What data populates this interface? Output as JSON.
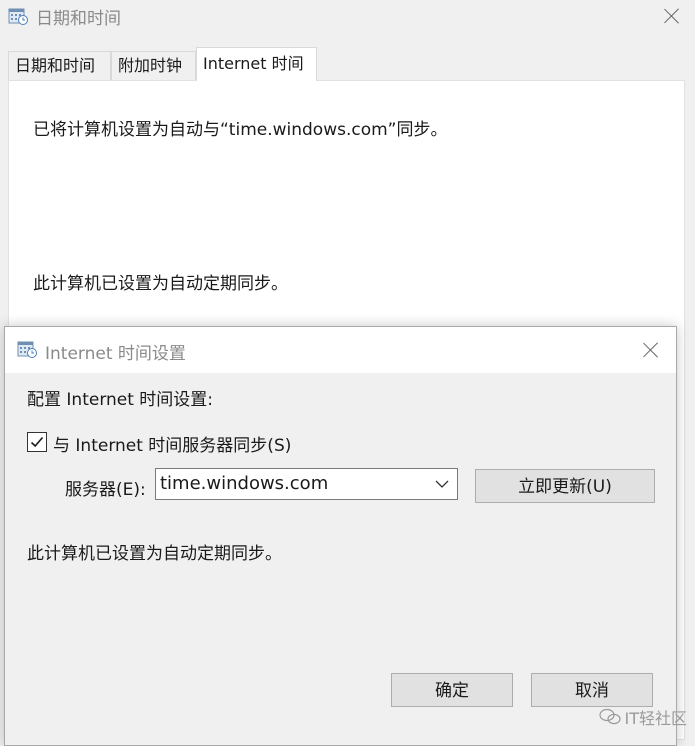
{
  "back_window": {
    "title": "日期和时间",
    "tabs": [
      {
        "label": "日期和时间"
      },
      {
        "label": "附加时钟"
      },
      {
        "label": "Internet 时间"
      }
    ],
    "active_tab": "Internet 时间",
    "panel": {
      "sync_status": "已将计算机设置为自动与“time.windows.com”同步。",
      "auto_sync_note": "此计算机已设置为自动定期同步。"
    }
  },
  "dialog": {
    "title": "Internet 时间设置",
    "heading": "配置 Internet 时间设置:",
    "sync_checkbox": {
      "label": "与 Internet 时间服务器同步(S)",
      "checked": true
    },
    "server_label": "服务器(E):",
    "server_value": "time.windows.com",
    "update_now_label": "立即更新(U)",
    "status_text": "此计算机已设置为自动定期同步。",
    "ok_label": "确定",
    "cancel_label": "取消"
  },
  "watermark": {
    "text": "IT轻社区",
    "icon": "wechat-icon"
  },
  "icons": {
    "app": "calendar-clock-icon",
    "close": "close-icon",
    "dropdown": "chevron-down-icon",
    "check": "checkmark-icon"
  }
}
